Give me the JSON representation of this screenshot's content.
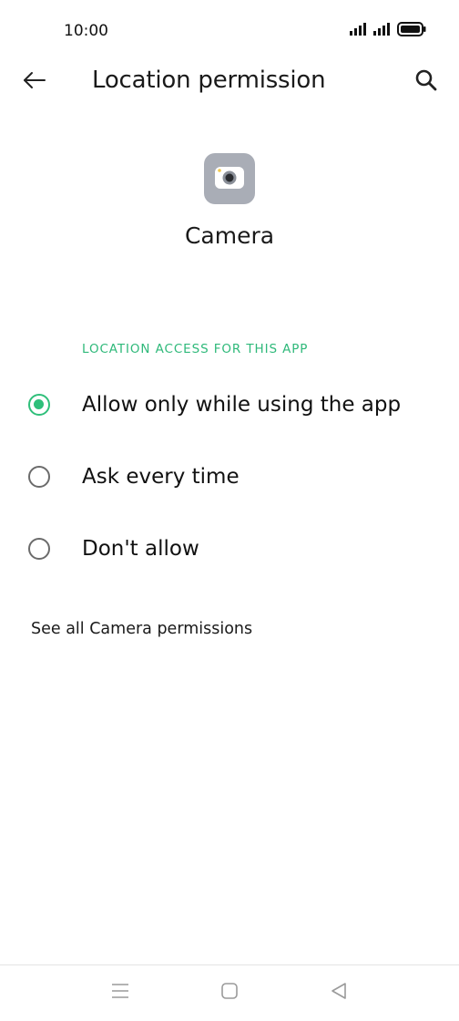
{
  "status_bar": {
    "time": "10:00",
    "icons": [
      "signal-icon",
      "signal-icon",
      "battery-icon"
    ]
  },
  "header": {
    "back_icon": "arrow-left-icon",
    "title": "Location permission",
    "search_icon": "search-icon"
  },
  "app": {
    "icon": "camera-icon",
    "name": "Camera"
  },
  "section": {
    "header": "LOCATION ACCESS FOR THIS APP",
    "options": [
      {
        "label": "Allow only while using the app",
        "selected": true
      },
      {
        "label": "Ask every time",
        "selected": false
      },
      {
        "label": "Don't allow",
        "selected": false
      }
    ]
  },
  "footer_link": "See all Camera permissions",
  "nav_bar": {
    "icons": [
      "menu-icon",
      "home-icon",
      "back-triangle-icon"
    ]
  },
  "colors": {
    "accent": "#2fbf7a",
    "section_header": "#2fb97a",
    "app_icon_bg": "#a9adb6"
  }
}
